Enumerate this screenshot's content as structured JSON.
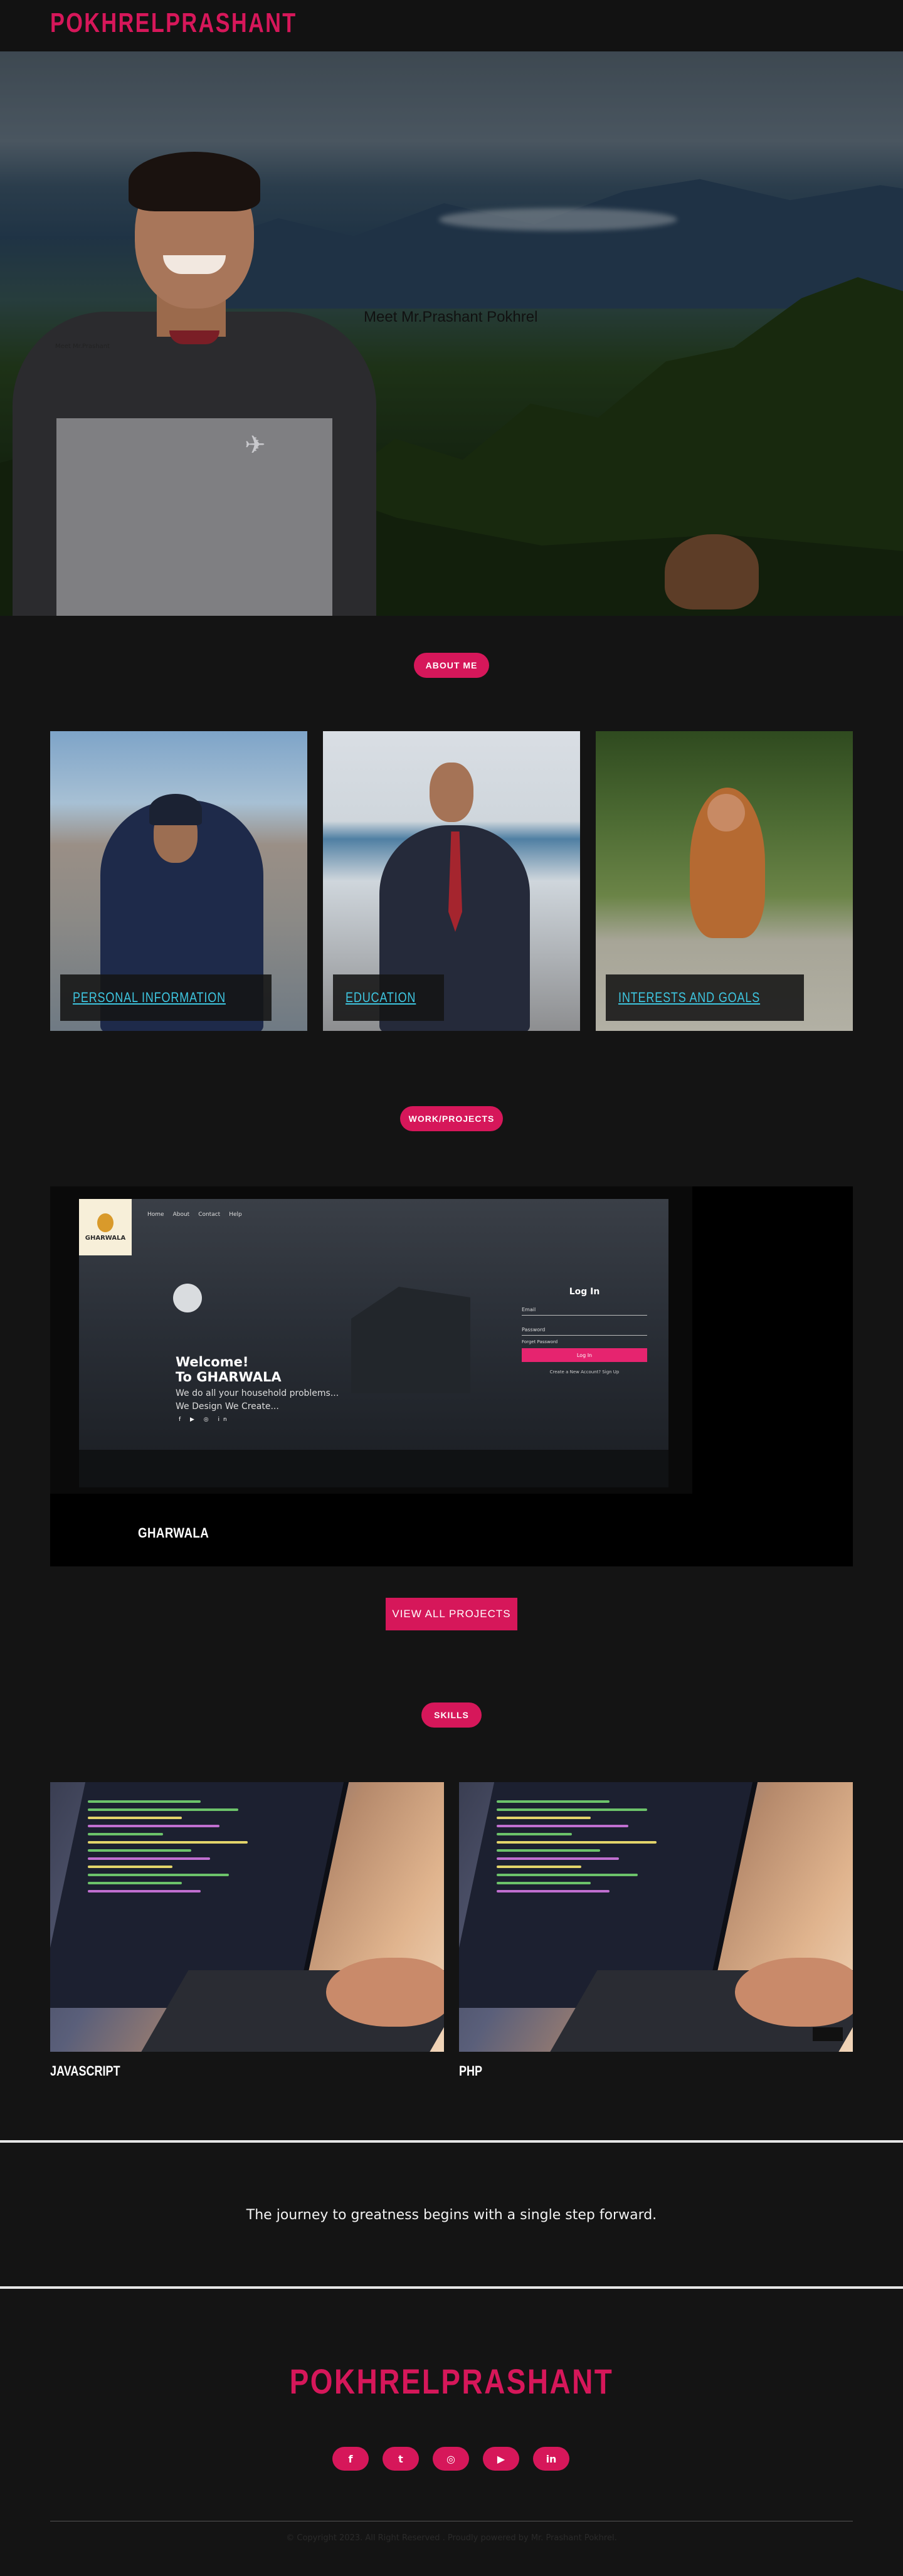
{
  "header": {
    "brand": "POKHRELPRASHANT"
  },
  "hero": {
    "caption": "Meet Mr.Prashant Pokhrel",
    "small_text": "Meet Mr.Prashant"
  },
  "about": {
    "pill": "ABOUT ME",
    "cards": [
      {
        "label": "PERSONAL INFORMATION"
      },
      {
        "label": "EDUCATION"
      },
      {
        "label": "INTERESTS AND GOALS"
      }
    ]
  },
  "projects": {
    "pill": "WORK/PROJECTS",
    "items": [
      {
        "name": "GHARWALA",
        "screenshot": {
          "logo_text": "GHARWALA",
          "nav": [
            "Home",
            "About",
            "Contact",
            "Help"
          ],
          "welcome_line1": "Welcome!",
          "welcome_line2": "To GHARWALA",
          "tagline_line1": "We do all your household problems...",
          "tagline_line2": "We Design We Create...",
          "social": "f ▶ ◎ in",
          "login": {
            "title": "Log In",
            "email_label": "Email",
            "password_label": "Password",
            "forgot": "Forget Password",
            "button": "Log In",
            "signup": "Create a New Account? Sign Up"
          }
        }
      }
    ],
    "view_all": "VIEW ALL PROJECTS"
  },
  "skills": {
    "pill": "SKILLS",
    "items": [
      {
        "title": "JAVASCRIPT"
      },
      {
        "title": "PHP"
      }
    ]
  },
  "quote": {
    "text": "The journey to greatness begins with a single step forward."
  },
  "footer": {
    "brand": "POKHRELPRASHANT",
    "socials": [
      {
        "icon": "facebook-icon",
        "glyph": "f"
      },
      {
        "icon": "twitter-icon",
        "glyph": "t"
      },
      {
        "icon": "instagram-icon",
        "glyph": "◎"
      },
      {
        "icon": "youtube-icon",
        "glyph": "▶"
      },
      {
        "icon": "linkedin-icon",
        "glyph": "in"
      }
    ],
    "copyright": "© Copyright 2023. All Right Reserved . Proudly powered by Mr. Prashant Pokhrel."
  },
  "colors": {
    "accent": "#d6175a",
    "link": "#3ec6e0",
    "background": "#141414"
  }
}
